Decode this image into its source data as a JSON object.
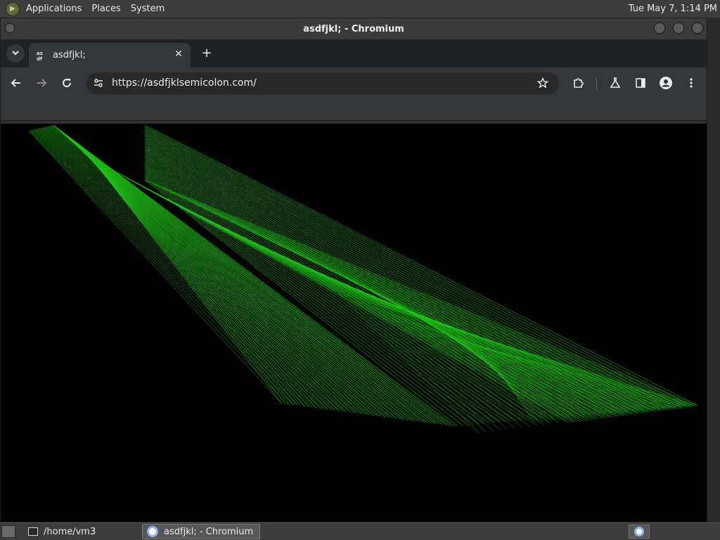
{
  "top_panel": {
    "menus": [
      "Applications",
      "Places",
      "System"
    ],
    "clock": "Tue May 7, 1:14 PM"
  },
  "window": {
    "title": "asdfjkl; - Chromium"
  },
  "browser": {
    "tab": {
      "favicon_text": "as\ndf",
      "title": "asdfjkl;",
      "close_glyph": "✕"
    },
    "new_tab_glyph": "+",
    "omnibox": {
      "url": "https://asdfjklsemicolon.com/"
    }
  },
  "taskbar": {
    "items": [
      {
        "label": "/home/vm3",
        "active": false
      },
      {
        "label": "asdfjkl; - Chromium",
        "active": true
      }
    ]
  },
  "colors": {
    "laser": "#22c41a",
    "content_bg": "#000000",
    "panel": "#3c3c3c",
    "toolbar": "#35363a"
  },
  "icons": {
    "back": "arrow-left-icon",
    "forward": "arrow-right-icon",
    "reload": "reload-icon",
    "site_info": "tune-icon",
    "bookmark": "star-icon",
    "extensions": "puzzle-icon",
    "labs": "flask-icon",
    "side_panel": "side-panel-icon",
    "profile": "profile-icon",
    "menu": "kebab-menu-icon"
  }
}
